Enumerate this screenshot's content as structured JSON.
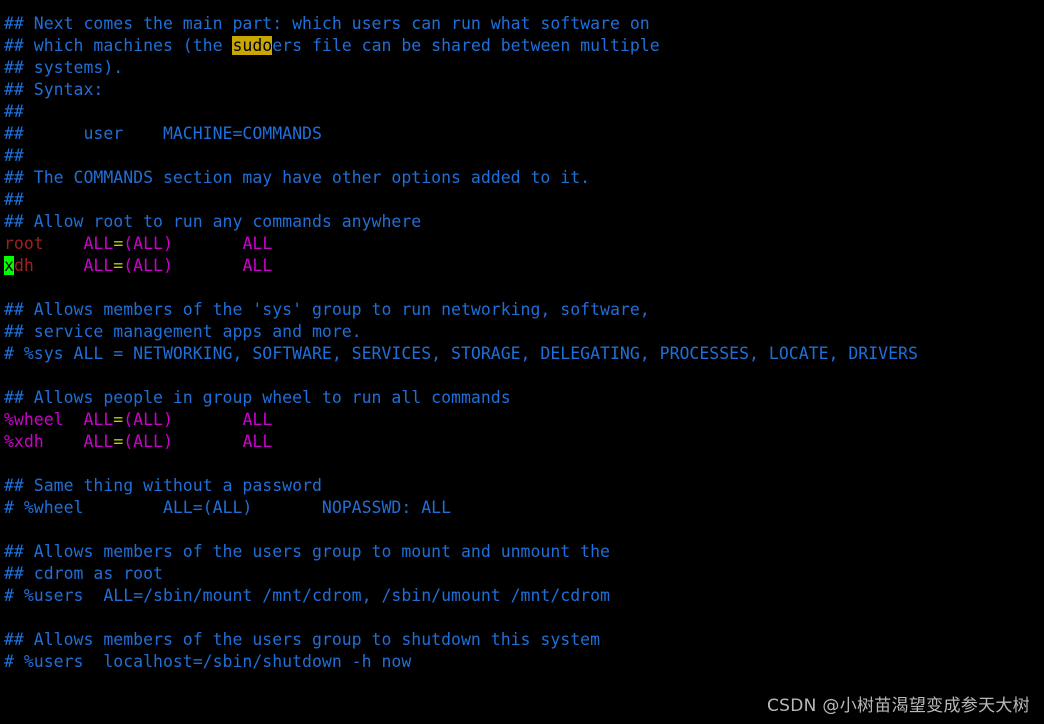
{
  "terminal": {
    "background_color": "#000000",
    "comment_color": "#1f6fd8",
    "user_color": "#a02020",
    "group_color": "#cc00cc",
    "equals_color": "#c8c800",
    "search_highlight_bg": "#c8a800",
    "cursor_bg": "#00ff00",
    "file_title": "sudoers"
  },
  "lines": [
    {
      "id": "l1",
      "segments": [
        {
          "text": "## Next comes the main part: which users can run what software on",
          "style": "comment"
        }
      ]
    },
    {
      "id": "l2",
      "segments": [
        {
          "text": "## which machines (the ",
          "style": "comment"
        },
        {
          "text": "sudo",
          "style": "search"
        },
        {
          "text": "ers file can be shared between multiple",
          "style": "comment"
        }
      ]
    },
    {
      "id": "l3",
      "segments": [
        {
          "text": "## systems).",
          "style": "comment"
        }
      ]
    },
    {
      "id": "l4",
      "segments": [
        {
          "text": "## Syntax:",
          "style": "comment"
        }
      ]
    },
    {
      "id": "l5",
      "segments": [
        {
          "text": "##",
          "style": "comment"
        }
      ]
    },
    {
      "id": "l6",
      "segments": [
        {
          "text": "##      user    MACHINE=COMMANDS",
          "style": "comment"
        }
      ]
    },
    {
      "id": "l7",
      "segments": [
        {
          "text": "##",
          "style": "comment"
        }
      ]
    },
    {
      "id": "l8",
      "segments": [
        {
          "text": "## The COMMANDS section may have other options added to it.",
          "style": "comment"
        }
      ]
    },
    {
      "id": "l9",
      "segments": [
        {
          "text": "##",
          "style": "comment"
        }
      ]
    },
    {
      "id": "l10",
      "segments": [
        {
          "text": "## Allow root to run any commands anywhere",
          "style": "comment"
        }
      ]
    },
    {
      "id": "l11",
      "segments": [
        {
          "text": "root",
          "style": "user"
        },
        {
          "text": "    ",
          "style": "plain"
        },
        {
          "text": "ALL",
          "style": "all"
        },
        {
          "text": "=",
          "style": "eq"
        },
        {
          "text": "(ALL)",
          "style": "all"
        },
        {
          "text": "       ",
          "style": "plain"
        },
        {
          "text": "ALL",
          "style": "all"
        }
      ]
    },
    {
      "id": "l12",
      "segments": [
        {
          "text": "x",
          "style": "cursor"
        },
        {
          "text": "dh",
          "style": "user"
        },
        {
          "text": "     ",
          "style": "plain"
        },
        {
          "text": "ALL",
          "style": "all"
        },
        {
          "text": "=",
          "style": "eq"
        },
        {
          "text": "(ALL)",
          "style": "all"
        },
        {
          "text": "       ",
          "style": "plain"
        },
        {
          "text": "ALL",
          "style": "all"
        }
      ]
    },
    {
      "id": "l13",
      "segments": [
        {
          "text": "",
          "style": "plain"
        }
      ]
    },
    {
      "id": "l14",
      "segments": [
        {
          "text": "## Allows members of the 'sys' group to run networking, software,",
          "style": "comment"
        }
      ]
    },
    {
      "id": "l15",
      "segments": [
        {
          "text": "## service management apps and more.",
          "style": "comment"
        }
      ]
    },
    {
      "id": "l16",
      "segments": [
        {
          "text": "# %sys ALL = NETWORKING, SOFTWARE, SERVICES, STORAGE, DELEGATING, PROCESSES, LOCATE, DRIVERS",
          "style": "comment"
        }
      ]
    },
    {
      "id": "l17",
      "segments": [
        {
          "text": "",
          "style": "plain"
        }
      ]
    },
    {
      "id": "l18",
      "segments": [
        {
          "text": "## Allows people in group wheel to run all commands",
          "style": "comment"
        }
      ]
    },
    {
      "id": "l19",
      "segments": [
        {
          "text": "%wheel",
          "style": "group"
        },
        {
          "text": "  ",
          "style": "plain"
        },
        {
          "text": "ALL",
          "style": "all"
        },
        {
          "text": "=",
          "style": "eq"
        },
        {
          "text": "(ALL)",
          "style": "all"
        },
        {
          "text": "       ",
          "style": "plain"
        },
        {
          "text": "ALL",
          "style": "all"
        }
      ]
    },
    {
      "id": "l20",
      "segments": [
        {
          "text": "%xdh",
          "style": "group"
        },
        {
          "text": "    ",
          "style": "plain"
        },
        {
          "text": "ALL",
          "style": "all"
        },
        {
          "text": "=",
          "style": "eq"
        },
        {
          "text": "(ALL)",
          "style": "all"
        },
        {
          "text": "       ",
          "style": "plain"
        },
        {
          "text": "ALL",
          "style": "all"
        }
      ]
    },
    {
      "id": "l21",
      "segments": [
        {
          "text": "",
          "style": "plain"
        }
      ]
    },
    {
      "id": "l22",
      "segments": [
        {
          "text": "## Same thing without a password",
          "style": "comment"
        }
      ]
    },
    {
      "id": "l23",
      "segments": [
        {
          "text": "# %wheel        ALL=(ALL)       NOPASSWD: ALL",
          "style": "comment"
        }
      ]
    },
    {
      "id": "l24",
      "segments": [
        {
          "text": "",
          "style": "plain"
        }
      ]
    },
    {
      "id": "l25",
      "segments": [
        {
          "text": "## Allows members of the users group to mount and unmount the",
          "style": "comment"
        }
      ]
    },
    {
      "id": "l26",
      "segments": [
        {
          "text": "## cdrom as root",
          "style": "comment"
        }
      ]
    },
    {
      "id": "l27",
      "segments": [
        {
          "text": "# %users  ALL=/sbin/mount /mnt/cdrom, /sbin/umount /mnt/cdrom",
          "style": "comment"
        }
      ]
    },
    {
      "id": "l28",
      "segments": [
        {
          "text": "",
          "style": "plain"
        }
      ]
    },
    {
      "id": "l29",
      "segments": [
        {
          "text": "## Allows members of the users group to shutdown this system",
          "style": "comment"
        }
      ]
    },
    {
      "id": "l30",
      "segments": [
        {
          "text": "# %users  localhost=/sbin/shutdown -h now",
          "style": "comment"
        }
      ]
    }
  ],
  "watermark": {
    "text": "CSDN @小树苗渴望变成参天大树"
  }
}
